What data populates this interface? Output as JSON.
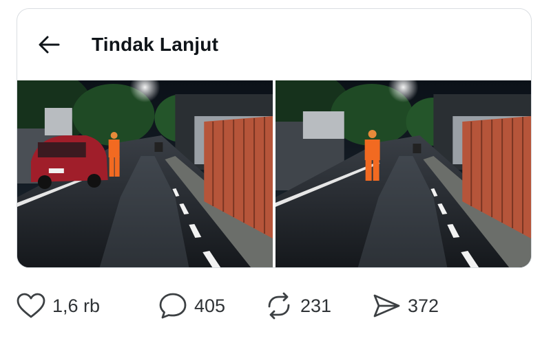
{
  "header": {
    "title": "Tindak Lanjut",
    "back_icon": "arrow-left-icon"
  },
  "media": {
    "photos": [
      {
        "alt_name": "night-street-photo-1"
      },
      {
        "alt_name": "night-street-photo-2"
      }
    ]
  },
  "actions": {
    "like": {
      "icon": "heart-icon",
      "count": "1,6 rb"
    },
    "reply": {
      "icon": "comment-bubble-icon",
      "count": "405"
    },
    "repost": {
      "icon": "repost-icon",
      "count": "231"
    },
    "share": {
      "icon": "send-icon",
      "count": "372"
    }
  },
  "colors": {
    "text": "#0f1419",
    "icon": "#3c4043",
    "card_border": "#d9dde1",
    "vest_orange": "#f26a21"
  }
}
